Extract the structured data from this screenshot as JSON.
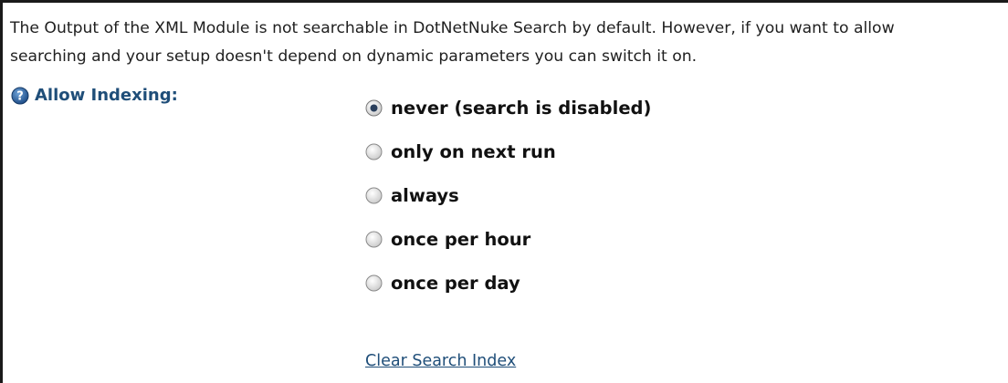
{
  "description": {
    "line1": "The Output of the XML Module is not searchable in DotNetNuke Search by default. However, if you want to allow",
    "line2": "searching and your setup doesn't depend on dynamic parameters you can switch it on."
  },
  "indexing": {
    "label": "Allow Indexing:",
    "help_icon": "help-icon",
    "options": [
      {
        "label": "never (search is disabled)",
        "selected": true
      },
      {
        "label": "only on next run",
        "selected": false
      },
      {
        "label": "always",
        "selected": false
      },
      {
        "label": "once per hour",
        "selected": false
      },
      {
        "label": "once per day",
        "selected": false
      }
    ]
  },
  "clear_link": "Clear Search Index",
  "colors": {
    "label_blue": "#1f4e79",
    "text": "#1f1f1f",
    "border": "#1a1a1a"
  }
}
